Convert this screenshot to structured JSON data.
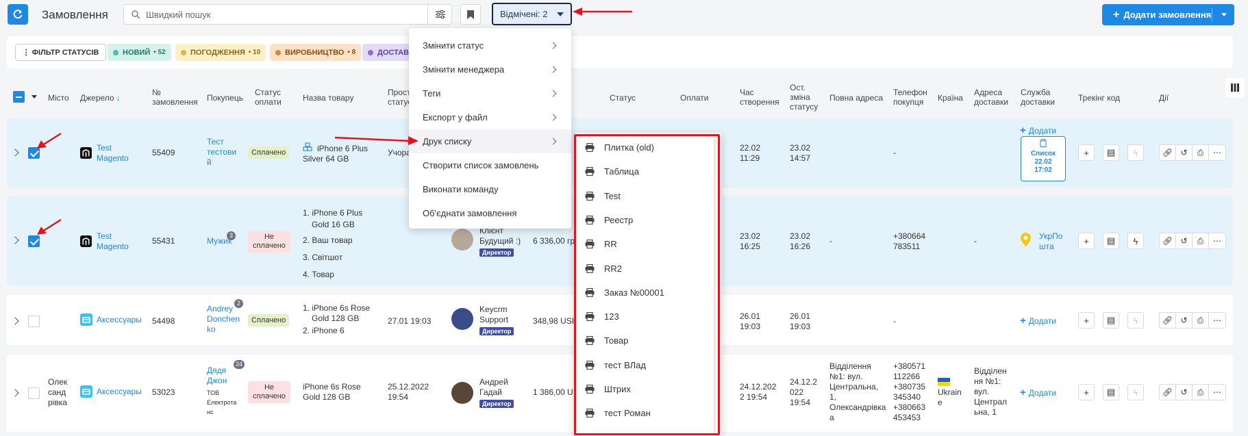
{
  "header": {
    "title": "Замовлення",
    "search_placeholder": "Швидкий пошук",
    "selected_label": "Відмічені: 2",
    "add_order_label": "Додати замовлення"
  },
  "status_filter": {
    "button_label": "ФІЛЬТР СТАТУСІВ",
    "chips": [
      {
        "label": "НОВИЙ",
        "count": "52",
        "color": "#4dc0a9",
        "bg": "#d4f1ea"
      },
      {
        "label": "ПОГОДЖЕННЯ",
        "count": "10",
        "color": "#d9b64a",
        "bg": "#fbf0c8"
      },
      {
        "label": "ВИРОБНИЦТВО",
        "count": "8",
        "color": "#d08a3d",
        "bg": "#fbe2c7"
      },
      {
        "label": "ДОСТАВ",
        "count": "",
        "color": "#8a6fd1",
        "bg": "#e3dbf7"
      }
    ]
  },
  "table_headers": {
    "city": "Місто",
    "source": "Джерело",
    "order_no": [
      "№",
      "замовлення"
    ],
    "buyer": "Покупець",
    "pay_status": [
      "Статус",
      "оплати"
    ],
    "product": "Назва товару",
    "overdue": [
      "Прост",
      "статус"
    ],
    "status": "Статус",
    "payments": "Оплати",
    "created": [
      "Час",
      "створення"
    ],
    "last_change": [
      "Ост.",
      "зміна",
      "статусу"
    ],
    "full_address": "Повна адреса",
    "phone": [
      "Телефон",
      "покупця"
    ],
    "country": "Країна",
    "delivery_address": [
      "Адреса",
      "доставки"
    ],
    "delivery_service": [
      "Служба",
      "доставки"
    ],
    "tracking": "Трекінг код",
    "actions": "Дії"
  },
  "rows": [
    {
      "selected": true,
      "city": "",
      "source": [
        "Test",
        "Magento"
      ],
      "order_no": "55409",
      "buyer": [
        "Тест",
        "тестови",
        "й"
      ],
      "buyer_count": "",
      "pay_status": "Сплачено",
      "products": [
        "iPhone 6 Plus",
        "Silver 64 GB"
      ],
      "overdue": "Учора",
      "created": [
        "22.02",
        "11:29"
      ],
      "last_change": [
        "23.02",
        "14:57"
      ],
      "phone": [
        "-"
      ],
      "delivery_add": "Додати",
      "list_card": [
        "Список",
        "22.02",
        "17:02"
      ]
    },
    {
      "selected": true,
      "city": "",
      "source": [
        "Test",
        "Magento"
      ],
      "order_no": "55431",
      "buyer": [
        "Мужик"
      ],
      "buyer_count": "3",
      "pay_status": [
        "Не",
        "сплачено"
      ],
      "products": [
        "1. iPhone 6 Plus",
        "Gold 16 GB",
        "2. Ваш товар",
        "3. Світшот",
        "4. Товар"
      ],
      "manager": [
        "Клієнт",
        "Будущий :)"
      ],
      "manager_role": "Директор",
      "payments": "6 336,00 гр",
      "created": [
        "23.02",
        "16:25"
      ],
      "last_change": [
        "23.02",
        "16:26"
      ],
      "full_address": "-",
      "phone": [
        "+380664",
        "783511"
      ],
      "delivery_address": "-",
      "delivery_service": [
        "УкрПо",
        "шта"
      ]
    },
    {
      "selected": false,
      "city": "",
      "source": [
        "Аксессуары"
      ],
      "order_no": "54498",
      "buyer": [
        "Andrey",
        "Donchen",
        "ko"
      ],
      "buyer_count": "2",
      "pay_status": "Сплачено",
      "products": [
        "1. iPhone 6s Rose",
        "Gold 128 GB",
        "2. iPhone 6"
      ],
      "overdue": "27.01 19:03",
      "manager": [
        "Keycrm",
        "Support"
      ],
      "manager_role": "Директор",
      "payments": "348,98 USI",
      "created": [
        "26.01",
        "19:03"
      ],
      "last_change": [
        "26.01",
        "19:03"
      ],
      "phone": [
        "-"
      ],
      "delivery_add": "Додати"
    },
    {
      "selected": false,
      "city": [
        "Олек",
        "санд",
        "рівка"
      ],
      "source": [
        "Аксессуары"
      ],
      "order_no": "53023",
      "buyer": [
        "Дядя",
        "Джон"
      ],
      "buyer_sub": [
        "ТОВ",
        "Електрота",
        "нс"
      ],
      "buyer_count": "24",
      "pay_status": [
        "Не",
        "сплачено"
      ],
      "products": [
        "iPhone 6s Rose",
        "Gold 128 GB"
      ],
      "overdue": [
        "25.12.2022",
        "19:54"
      ],
      "manager": [
        "Андрей",
        "Гадай"
      ],
      "manager_role": "Директор",
      "payments": "1 386,00 U",
      "created": [
        "24.12.202",
        "2 19:54"
      ],
      "last_change": [
        "24.12.2",
        "022",
        "19:54"
      ],
      "full_address": [
        "Відділення",
        "№1: вул.",
        "Центральна,",
        "1,",
        "Олександрівка",
        "а"
      ],
      "phone": [
        "+380571",
        "112266",
        "+380735",
        "345340",
        "+380663",
        "453453"
      ],
      "country": [
        "Ukrain",
        "e"
      ],
      "delivery_address": [
        "Відділен",
        "ня №1:",
        "вул.",
        "Централ",
        "ьна, 1"
      ],
      "delivery_add": "Додати"
    }
  ],
  "context_menu": {
    "items": [
      {
        "label": "Змінити статус",
        "submenu": true
      },
      {
        "label": "Змінити менеджера",
        "submenu": true
      },
      {
        "label": "Теги",
        "submenu": true
      },
      {
        "label": "Експорт у файл",
        "submenu": true
      },
      {
        "label": "Друк списку",
        "submenu": true
      },
      {
        "label": "Створити список замовлень",
        "submenu": false
      },
      {
        "label": "Виконати команду",
        "submenu": false
      },
      {
        "label": "Об'єднати замовлення",
        "submenu": false
      }
    ]
  },
  "print_submenu": {
    "items": [
      "Плитка (old)",
      "Таблица",
      "Test",
      "Реестр",
      "RR",
      "RR2",
      "Заказ №00001",
      "123",
      "Товар",
      "тест ВЛад",
      "Штрих",
      "тест Роман"
    ]
  },
  "colors": {
    "accent": "#1e88e5",
    "annotation_red": "#e3141e",
    "selected_row": "#e4f2fc"
  }
}
